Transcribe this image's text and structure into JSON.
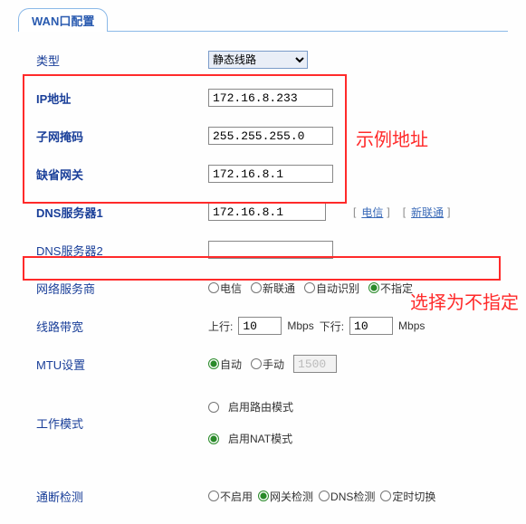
{
  "tab": {
    "title": "WAN口配置"
  },
  "rows": {
    "type": {
      "label": "类型",
      "select_value": "静态线路"
    },
    "ip": {
      "label": "IP地址",
      "value": "172.16.8.233"
    },
    "mask": {
      "label": "子网掩码",
      "value": "255.255.255.0"
    },
    "gw": {
      "label": "缺省网关",
      "value": "172.16.8.1"
    },
    "dns1": {
      "label": "DNS服务器1",
      "value": "172.16.8.1",
      "link1": "电信",
      "link2": "新联通"
    },
    "dns2": {
      "label": "DNS服务器2",
      "value": ""
    },
    "isp": {
      "label": "网络服务商",
      "options": {
        "o1": "电信",
        "o2": "新联通",
        "o3": "自动识别",
        "o4": "不指定"
      }
    },
    "bw": {
      "label": "线路带宽",
      "up_label": "上行:",
      "down_label": "下行:",
      "up_val": "10",
      "down_val": "10",
      "unit": "Mbps"
    },
    "mtu": {
      "label": "MTU设置",
      "auto": "自动",
      "manual": "手动",
      "manual_val": "1500"
    },
    "mode": {
      "label": "工作模式",
      "opt1": "启用路由模式",
      "opt2": "启用NAT模式"
    },
    "detect": {
      "label": "通断检测",
      "o1": "不启用",
      "o2": "网关检测",
      "o3": "DNS检测",
      "o4": "定时切换"
    }
  },
  "annotations": {
    "box1_text": "示例地址",
    "box2_text": "选择为不指定"
  }
}
